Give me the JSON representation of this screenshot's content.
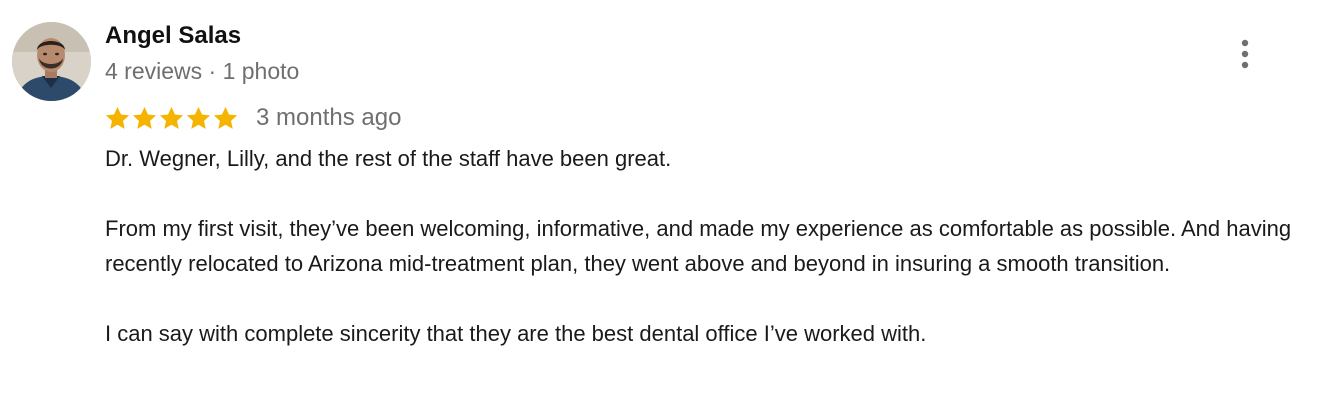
{
  "reviewer": {
    "name": "Angel Salas",
    "meta": "4 reviews · 1 photo",
    "avatar_icon": "reviewer-avatar-photo"
  },
  "rating": {
    "stars": 5,
    "max_stars": 5,
    "star_color": "#f4b400",
    "date": "3 months ago"
  },
  "menu": {
    "icon": "more-vertical-icon"
  },
  "review": {
    "paragraphs": [
      "Dr. Wegner, Lilly, and the rest of the staff have been great.",
      "From my first visit, they’ve been welcoming, informative, and made my experience as comfortable as possible. And having recently relocated to Arizona mid-treatment plan, they went above and beyond in insuring a smooth transition.",
      "I can say with complete sincerity that they are the best dental office I’ve worked with."
    ]
  }
}
